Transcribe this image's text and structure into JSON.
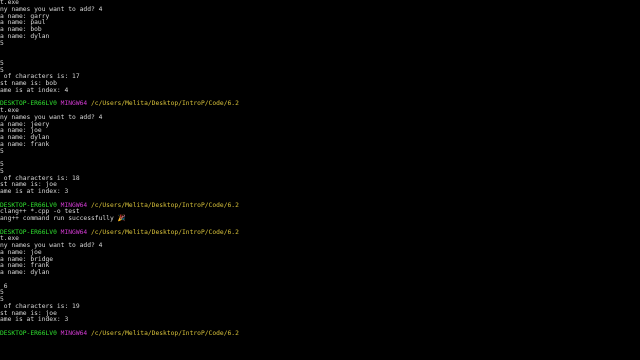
{
  "colors": {
    "background": "#000000",
    "text": "#d9d9d9",
    "prompt_user": "#2fe02f",
    "prompt_shell": "#d23ad2",
    "prompt_path": "#d8c23a"
  },
  "lines": [
    {
      "segs": [
        {
          "t": "t.exe",
          "c": "white"
        }
      ]
    },
    {
      "segs": [
        {
          "t": "ny names you want to add? 4",
          "c": "white"
        }
      ]
    },
    {
      "segs": [
        {
          "t": "a name: garry",
          "c": "white"
        }
      ]
    },
    {
      "segs": [
        {
          "t": "a name: paul",
          "c": "white"
        }
      ]
    },
    {
      "segs": [
        {
          "t": "a name: bob",
          "c": "white"
        }
      ]
    },
    {
      "segs": [
        {
          "t": "a name: dylan",
          "c": "white"
        }
      ]
    },
    {
      "segs": [
        {
          "t": "5",
          "c": "white"
        }
      ]
    },
    {
      "segs": []
    },
    {
      "segs": []
    },
    {
      "segs": [
        {
          "t": "5",
          "c": "white"
        }
      ]
    },
    {
      "segs": [
        {
          "t": "5",
          "c": "white"
        }
      ]
    },
    {
      "segs": [
        {
          "t": " of characters is: 17",
          "c": "white"
        }
      ]
    },
    {
      "segs": [
        {
          "t": "st name is: bob",
          "c": "white"
        }
      ]
    },
    {
      "segs": [
        {
          "t": "ame is at index: 4",
          "c": "white"
        }
      ]
    },
    {
      "segs": []
    },
    {
      "segs": [
        {
          "t": "DESKTOP-ER66LV0 ",
          "c": "green"
        },
        {
          "t": "MINGW64 ",
          "c": "magenta"
        },
        {
          "t": "/c/Users/Melita/Desktop/IntroP/Code/6.2",
          "c": "yellow"
        }
      ]
    },
    {
      "segs": [
        {
          "t": "t.exe",
          "c": "white"
        }
      ]
    },
    {
      "segs": [
        {
          "t": "ny names you want to add? 4",
          "c": "white"
        }
      ]
    },
    {
      "segs": [
        {
          "t": "a name: jeery",
          "c": "white"
        }
      ]
    },
    {
      "segs": [
        {
          "t": "a name: joe",
          "c": "white"
        }
      ]
    },
    {
      "segs": [
        {
          "t": "a name: dylan",
          "c": "white"
        }
      ]
    },
    {
      "segs": [
        {
          "t": "a name: frank",
          "c": "white"
        }
      ]
    },
    {
      "segs": [
        {
          "t": "5",
          "c": "white"
        }
      ]
    },
    {
      "segs": []
    },
    {
      "segs": [
        {
          "t": "5",
          "c": "white"
        }
      ]
    },
    {
      "segs": [
        {
          "t": "5",
          "c": "white"
        }
      ]
    },
    {
      "segs": [
        {
          "t": " of characters is: 18",
          "c": "white"
        }
      ]
    },
    {
      "segs": [
        {
          "t": "st name is: joe",
          "c": "white"
        }
      ]
    },
    {
      "segs": [
        {
          "t": "ame is at index: 3",
          "c": "white"
        }
      ]
    },
    {
      "segs": []
    },
    {
      "segs": [
        {
          "t": "DESKTOP-ER66LV0 ",
          "c": "green"
        },
        {
          "t": "MINGW64 ",
          "c": "magenta"
        },
        {
          "t": "/c/Users/Melita/Desktop/IntroP/Code/6.2",
          "c": "yellow"
        }
      ]
    },
    {
      "segs": [
        {
          "t": "clang++ *.cpp -o test",
          "c": "white"
        }
      ]
    },
    {
      "segs": [
        {
          "t": "ang++ command run successfully 🎉",
          "c": "white"
        }
      ]
    },
    {
      "segs": []
    },
    {
      "segs": [
        {
          "t": "DESKTOP-ER66LV0 ",
          "c": "green"
        },
        {
          "t": "MINGW64 ",
          "c": "magenta"
        },
        {
          "t": "/c/Users/Melita/Desktop/IntroP/Code/6.2",
          "c": "yellow"
        }
      ]
    },
    {
      "segs": [
        {
          "t": "t.exe",
          "c": "white"
        }
      ]
    },
    {
      "segs": [
        {
          "t": "ny names you want to add? 4",
          "c": "white"
        }
      ]
    },
    {
      "segs": [
        {
          "t": "a name: joe",
          "c": "white"
        }
      ]
    },
    {
      "segs": [
        {
          "t": "a name: bridge",
          "c": "white"
        }
      ]
    },
    {
      "segs": [
        {
          "t": "a name: frank",
          "c": "white"
        }
      ]
    },
    {
      "segs": [
        {
          "t": "a name: dylan",
          "c": "white"
        }
      ]
    },
    {
      "segs": []
    },
    {
      "segs": [
        {
          "t": " 6",
          "c": "white"
        }
      ]
    },
    {
      "segs": [
        {
          "t": "5",
          "c": "white"
        }
      ]
    },
    {
      "segs": [
        {
          "t": "5",
          "c": "white"
        }
      ]
    },
    {
      "segs": [
        {
          "t": " of characters is: 19",
          "c": "white"
        }
      ]
    },
    {
      "segs": [
        {
          "t": "st name is: joe",
          "c": "white"
        }
      ]
    },
    {
      "segs": [
        {
          "t": "ame is at index: 3",
          "c": "white"
        }
      ]
    },
    {
      "segs": []
    },
    {
      "segs": [
        {
          "t": "DESKTOP-ER66LV0 ",
          "c": "green"
        },
        {
          "t": "MINGW64 ",
          "c": "magenta"
        },
        {
          "t": "/c/Users/Melita/Desktop/IntroP/Code/6.2",
          "c": "yellow"
        }
      ]
    }
  ]
}
